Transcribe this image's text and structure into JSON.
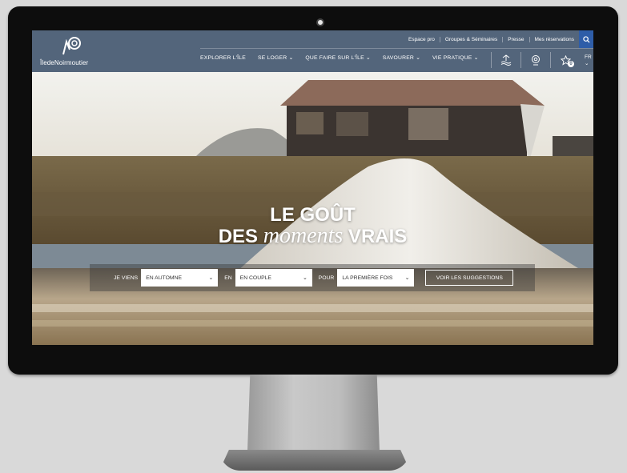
{
  "site": {
    "logo_text": "ÎledeNoirmoutier",
    "top_links": [
      "Espace pro",
      "Groupes & Séminaires",
      "Presse",
      "Mes réservations"
    ],
    "nav": [
      "EXPLORER L'ÎLE",
      "SE LOGER ⌄",
      "QUE FAIRE SUR L'ÎLE ⌄",
      "SAVOURER ⌄",
      "VIE PRATIQUE ⌄"
    ],
    "favorites_count": "0",
    "language": "FR",
    "language_chevron": "⌄"
  },
  "hero": {
    "title_line1": "LE GOÛT",
    "title_line2_pre": "DES ",
    "title_line2_em": "moments",
    "title_line2_post": " VRAIS"
  },
  "search": {
    "label1": "JE VIENS",
    "select1": "EN AUTOMNE",
    "label2": "EN",
    "select2": "EN COUPLE",
    "label3": "POUR",
    "select3": "LA PREMIÈRE FOIS",
    "chevron": "⌄",
    "button": "VOIR LES SUGGESTIONS"
  },
  "colors": {
    "header_bg": "#53657b",
    "search_accent": "#2e5da8"
  },
  "icons": [
    "camera-icon",
    "logo-spiral-icon",
    "search-icon",
    "tide-icon",
    "webcam-icon",
    "star-icon"
  ]
}
